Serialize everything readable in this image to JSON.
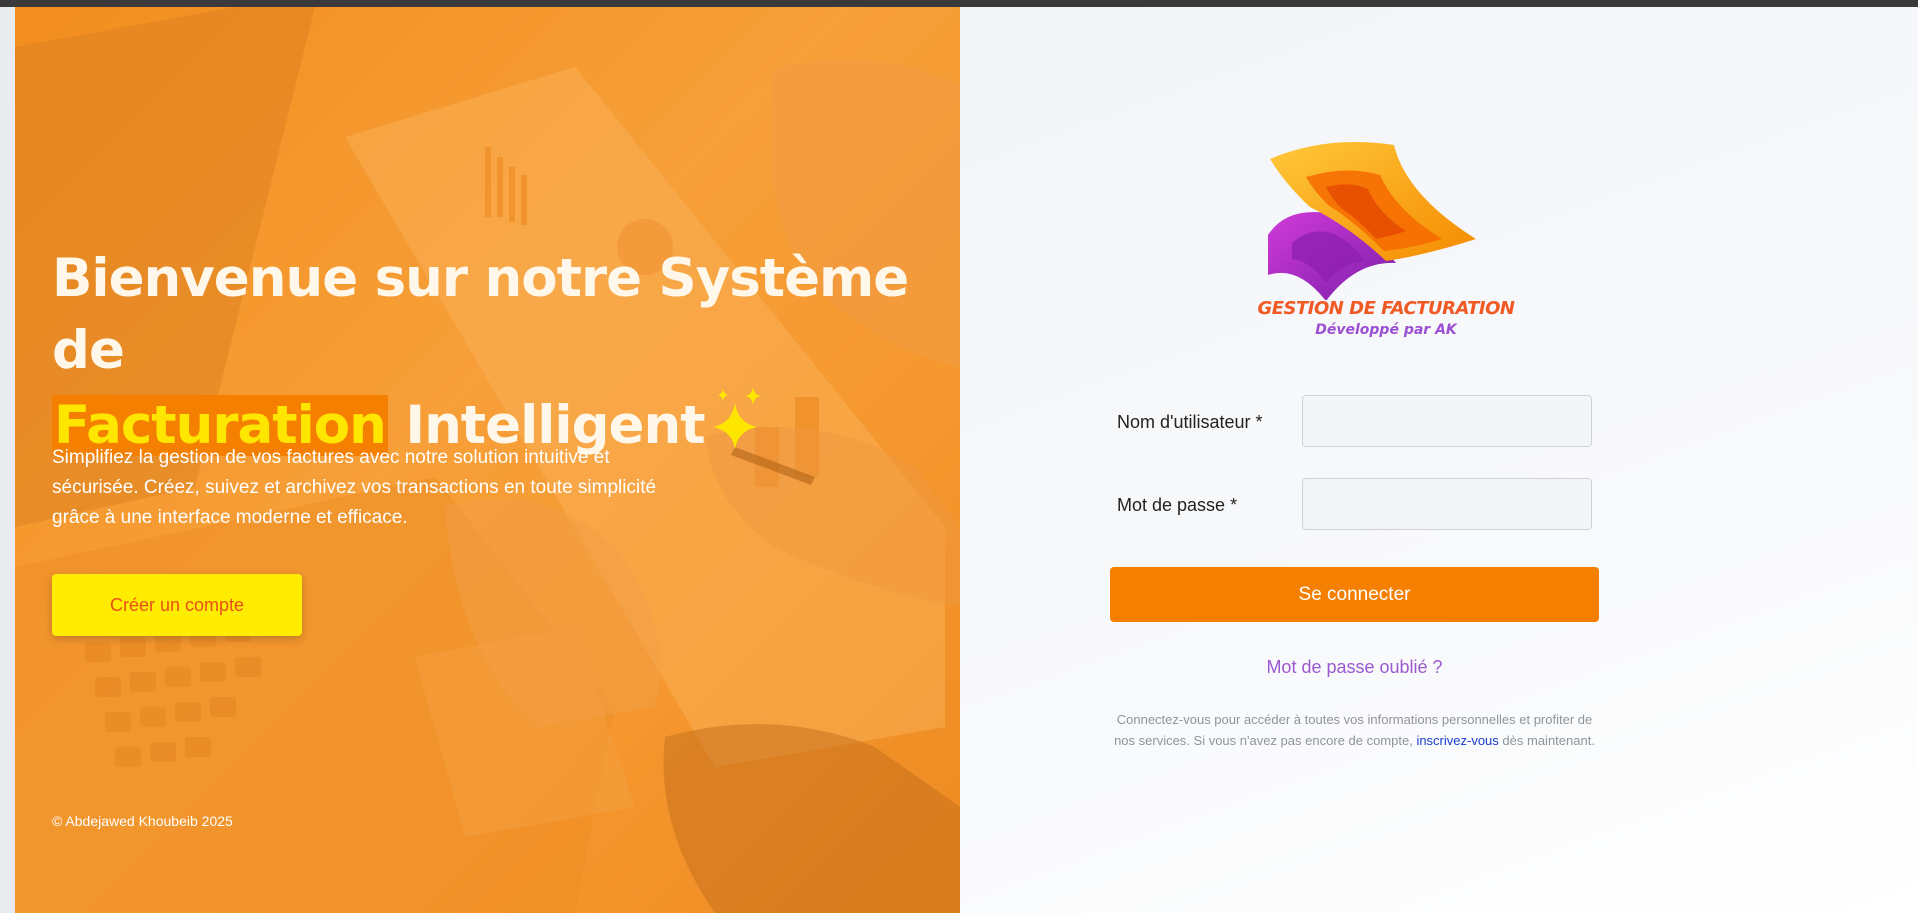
{
  "hero": {
    "title_part1": "Bienvenue sur notre Système de",
    "title_highlight": "Facturation",
    "title_part2": "Intelligent",
    "description": "Simplifiez la gestion de vos factures avec notre solution intuitive et sécurisée. Créez, suivez et archivez vos transactions en toute simplicité grâce à une interface moderne et efficace.",
    "cta_label": "Créer un compte",
    "footer": "© Abdejawed Khoubeib 2025",
    "sparkle_icon": "sparkles-icon"
  },
  "logo": {
    "title": "GESTION DE FACTURATION",
    "subtitle": "Développé par AK"
  },
  "login": {
    "username_label": "Nom d'utilisateur *",
    "username_value": "",
    "password_label": "Mot de passe *",
    "password_value": "",
    "submit_label": "Se connecter",
    "forgot_label": "Mot de passe oublié ?",
    "info_before": "Connectez-vous pour accéder à toutes vos informations personnelles et profiter de nos services. Si vous n'avez pas encore de compte,",
    "info_link": "inscrivez-vous",
    "info_after": "dès maintenant."
  },
  "colors": {
    "accent_orange": "#f57f00",
    "cta_yellow": "#ffec00",
    "highlight_yellow": "#ffe600",
    "link_purple": "#9b59d0",
    "signup_blue": "#1a3ccc"
  }
}
